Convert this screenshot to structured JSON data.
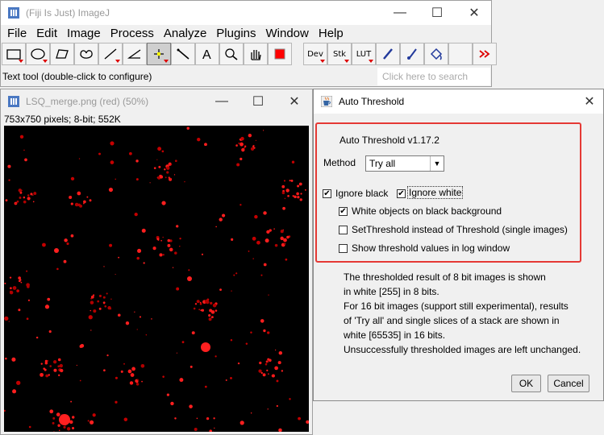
{
  "fiji": {
    "title": "(Fiji Is Just) ImageJ",
    "menu": [
      "File",
      "Edit",
      "Image",
      "Process",
      "Analyze",
      "Plugins",
      "Window",
      "Help"
    ],
    "tool_labels": {
      "dev": "Dev",
      "stk": "Stk",
      "lut": "LUT"
    },
    "status": "Text tool (double-click to configure)",
    "search_placeholder": "Click here to search",
    "colors": {
      "foreground_swatch": "#ff0000",
      "tool_marker": "#dd0000"
    }
  },
  "image_window": {
    "title": "LSQ_merge.png (red) (50%)",
    "info": "753x750 pixels; 8-bit; 552K"
  },
  "dialog": {
    "title": "Auto Threshold",
    "version": "Auto Threshold v1.17.2",
    "method_label": "Method",
    "method_value": "Try all",
    "ignore_black": {
      "label": "Ignore black",
      "checked": true
    },
    "ignore_white": {
      "label": "Ignore white",
      "checked": true
    },
    "white_objects": {
      "label": "White objects on black background",
      "checked": true
    },
    "set_threshold": {
      "label": "SetThreshold instead of Threshold (single images)",
      "checked": false
    },
    "show_log": {
      "label": "Show threshold values in log window",
      "checked": false
    },
    "help_lines": [
      "The thresholded result of 8 bit images is shown",
      "in white [255] in 8 bits.",
      "For 16 bit images (support still experimental), results",
      "of 'Try all' and single slices of a stack are shown in",
      "white [65535] in 16 bits.",
      "Unsuccessfully thresholded images are left unchanged."
    ],
    "ok_label": "OK",
    "cancel_label": "Cancel",
    "highlight_color": "#e53935"
  }
}
